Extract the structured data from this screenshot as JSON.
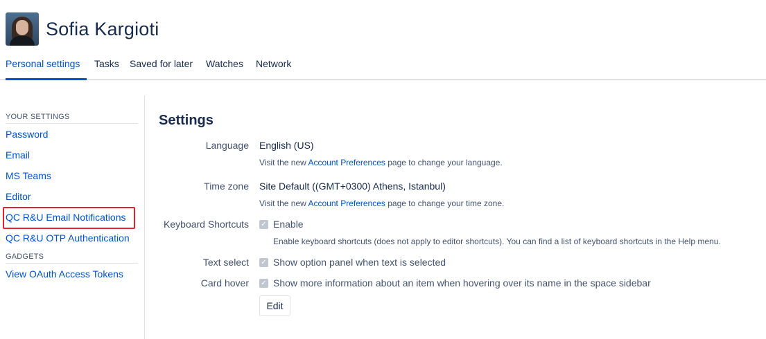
{
  "profile": {
    "name": "Sofia Kargioti"
  },
  "tabs": [
    {
      "label": "Personal settings"
    },
    {
      "label": "Tasks"
    },
    {
      "label": "Saved for later"
    },
    {
      "label": "Watches"
    },
    {
      "label": "Network"
    }
  ],
  "sidebar": {
    "your_settings_heading": "YOUR SETTINGS",
    "items": [
      {
        "label": "Password"
      },
      {
        "label": "Email"
      },
      {
        "label": "MS Teams"
      },
      {
        "label": "Editor"
      },
      {
        "label": "QC R&U Email Notifications"
      },
      {
        "label": "QC R&U OTP Authentication"
      }
    ],
    "gadgets_heading": "GADGETS",
    "gadget_items": [
      {
        "label": "View OAuth Access Tokens"
      }
    ]
  },
  "settings": {
    "title": "Settings",
    "language": {
      "label": "Language",
      "value": "English (US)",
      "hint_prefix": "Visit the new ",
      "hint_link": "Account Preferences",
      "hint_suffix": " page to change your language."
    },
    "timezone": {
      "label": "Time zone",
      "value": "Site Default ((GMT+0300) Athens, Istanbul)",
      "hint_prefix": "Visit the new ",
      "hint_link": "Account Preferences",
      "hint_suffix": " page to change your time zone."
    },
    "keyboard": {
      "label": "Keyboard Shortcuts",
      "checkbox_label": "Enable",
      "hint": "Enable keyboard shortcuts (does not apply to editor shortcuts). You can find a list of keyboard shortcuts in the Help menu."
    },
    "text_select": {
      "label": "Text select",
      "checkbox_label": "Show option panel when text is selected"
    },
    "card_hover": {
      "label": "Card hover",
      "checkbox_label": "Show more information about an item when hovering over its name in the space sidebar"
    },
    "edit_button": "Edit"
  },
  "colors": {
    "link": "#0052cc",
    "text": "#172b4d",
    "highlight_box": "#e5202e"
  }
}
